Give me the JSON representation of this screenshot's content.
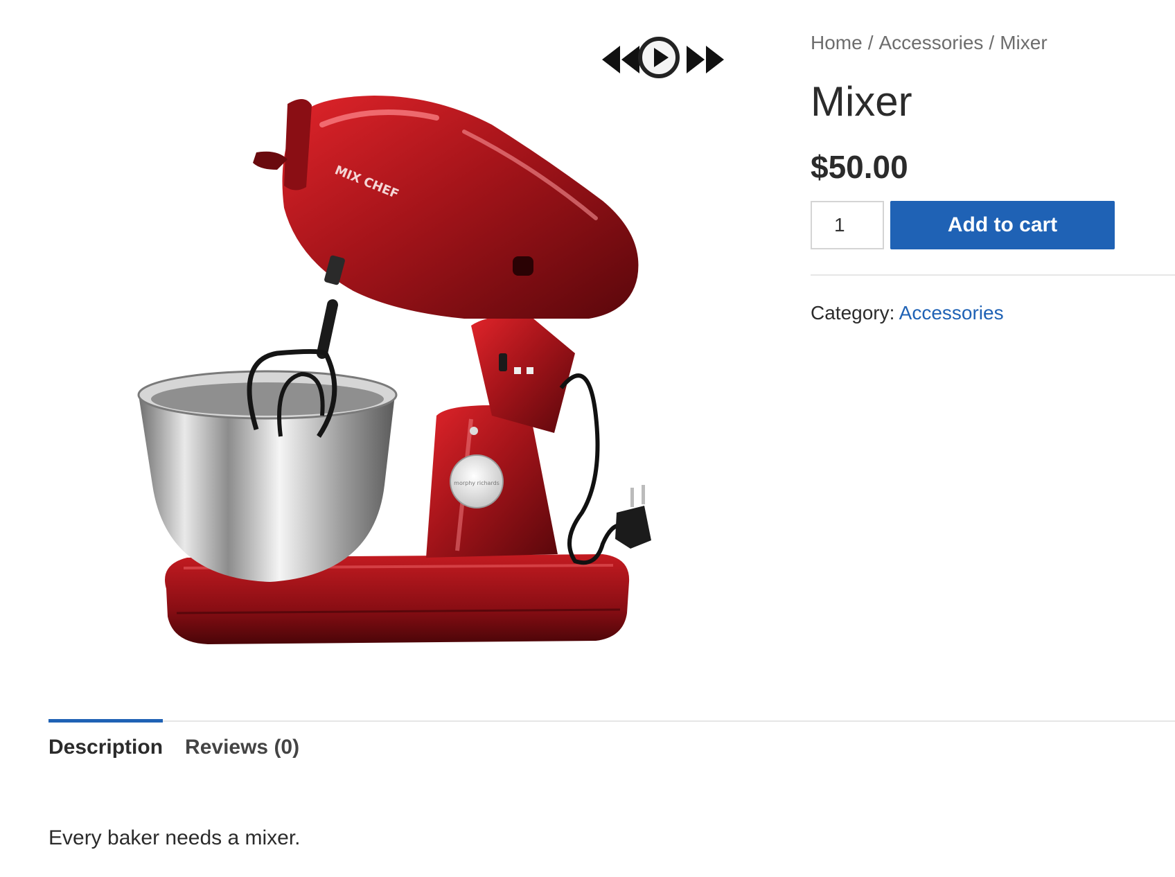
{
  "gallery": {
    "controls": {
      "previous": "rewind-icon",
      "play": "play-icon",
      "next": "fast-forward-icon"
    },
    "image_icon": "stand-mixer-image",
    "brand_text": "MIX CHEF",
    "plate_text": "morphy richards"
  },
  "breadcrumb": {
    "home": "Home",
    "separator": "/",
    "category": "Accessories",
    "current": "Mixer"
  },
  "product": {
    "title": "Mixer",
    "price": "$50.00",
    "quantity": "1",
    "add_to_cart_label": "Add to cart",
    "category_label": "Category:",
    "category_value": "Accessories"
  },
  "tabs": [
    {
      "label": "Description",
      "active": true
    },
    {
      "label": "Reviews (0)",
      "active": false
    }
  ],
  "description": "Every baker needs a mixer.",
  "colors": {
    "accent": "#1f62b5",
    "mixer_red": "#a5141a",
    "text": "#2b2b2b"
  }
}
